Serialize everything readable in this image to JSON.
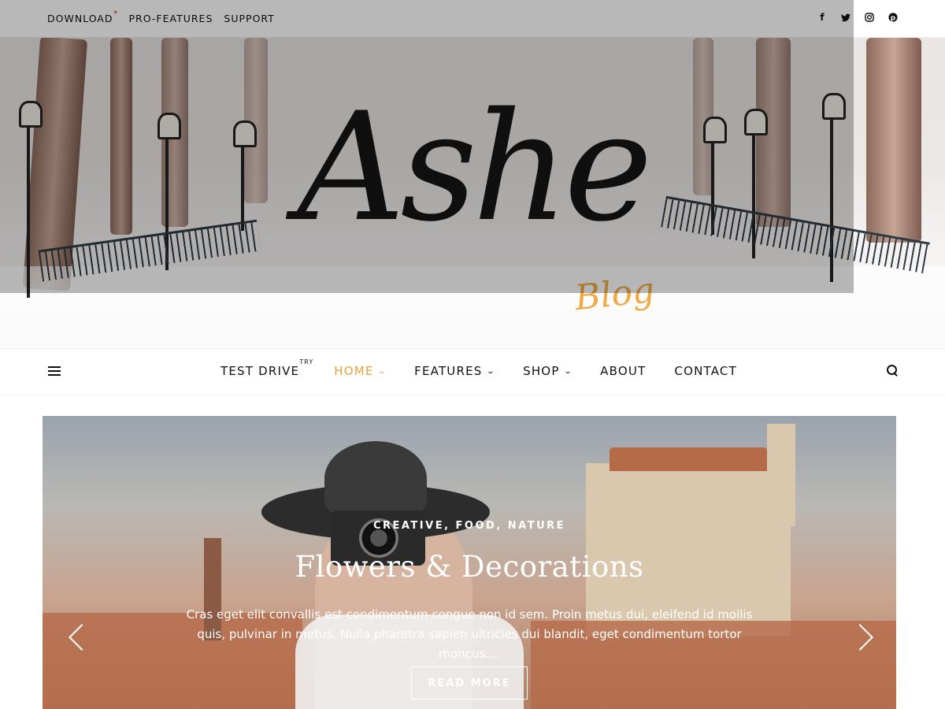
{
  "topbar": {
    "links": [
      "DOWNLOAD",
      "PRO-FEATURES",
      "SUPPORT"
    ],
    "download_mark": "*",
    "social_icons": [
      "facebook-icon",
      "twitter-icon",
      "instagram-icon",
      "pinterest-icon"
    ]
  },
  "header": {
    "logo_text": "Ashe",
    "logo_tagline": "Blog"
  },
  "nav": {
    "items": [
      {
        "label": "TEST DRIVE",
        "sup": "TRY",
        "dropdown": false,
        "active": false
      },
      {
        "label": "HOME",
        "sup": "",
        "dropdown": true,
        "active": true
      },
      {
        "label": "FEATURES",
        "sup": "",
        "dropdown": true,
        "active": false
      },
      {
        "label": "SHOP",
        "sup": "",
        "dropdown": true,
        "active": false
      },
      {
        "label": "ABOUT",
        "sup": "",
        "dropdown": false,
        "active": false
      },
      {
        "label": "CONTACT",
        "sup": "",
        "dropdown": false,
        "active": false
      }
    ],
    "dropdown_glyph": "⌄"
  },
  "slide": {
    "categories": "CREATIVE, FOOD, NATURE",
    "title": "Flowers & Decorations",
    "excerpt": "Cras eget elit convallis est condimentum congue non id sem. Proin metus dui, eleifend id mollis quis, pulvinar in metus. Nulla pharetra sapien ultricies dui blandit, eget condimentum tortor rhoncus....",
    "button_label": "READ MORE"
  },
  "colors": {
    "accent": "#e8a13c",
    "logo_tagline": "#f0a945",
    "text": "#111111",
    "star": "#e33333"
  }
}
